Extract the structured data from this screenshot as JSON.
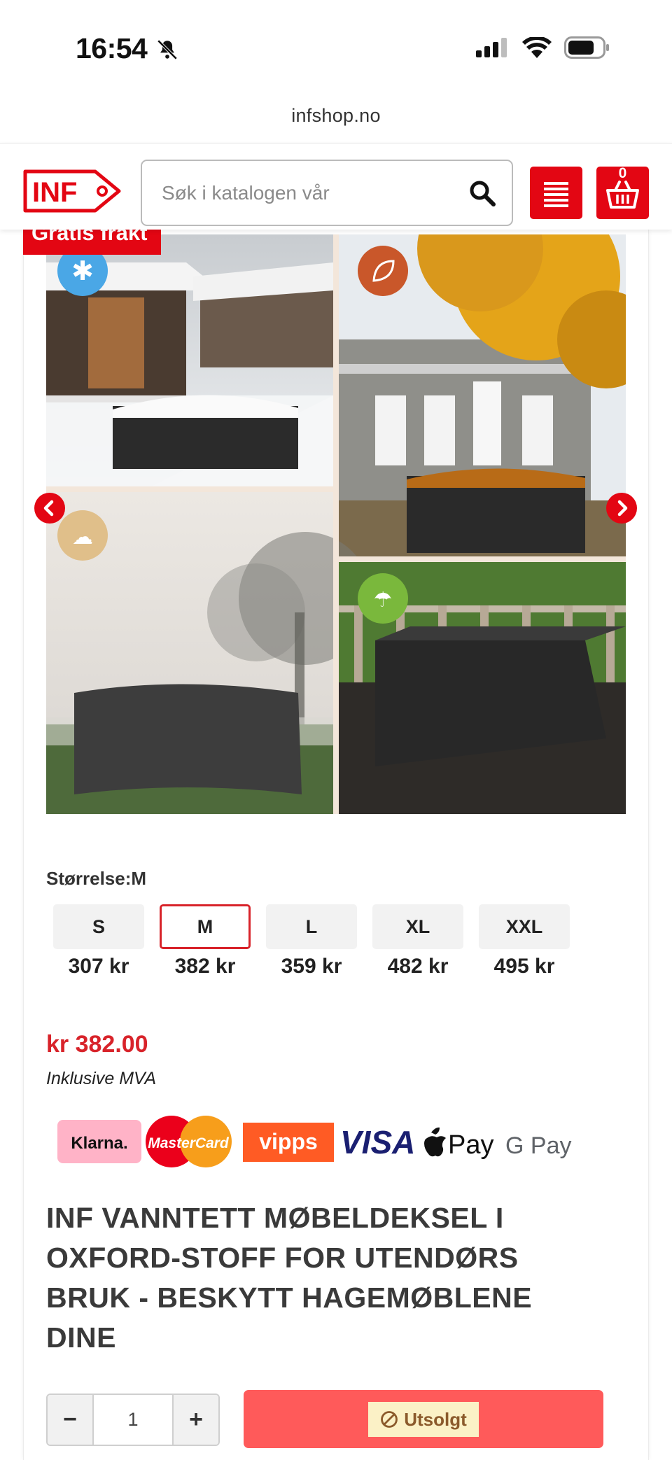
{
  "status_bar": {
    "time": "16:54"
  },
  "browser": {
    "url": "infshop.no"
  },
  "header": {
    "logo_text": "INF",
    "search_placeholder": "Søk i katalogen vår",
    "cart_count": "0"
  },
  "product": {
    "badge": "Gratis frakt",
    "size_label": "Størrelse:M",
    "sizes": [
      {
        "label": "S",
        "price": "307 kr",
        "selected": false
      },
      {
        "label": "M",
        "price": "382 kr",
        "selected": true
      },
      {
        "label": "L",
        "price": "359 kr",
        "selected": false
      },
      {
        "label": "XL",
        "price": "482 kr",
        "selected": false
      },
      {
        "label": "XXL",
        "price": "495 kr",
        "selected": false
      }
    ],
    "price": "kr 382.00",
    "vat_note": "Inklusive MVA",
    "payment_methods": [
      "Klarna.",
      "MasterCard",
      "vipps",
      "VISA",
      "Pay",
      "G Pay"
    ],
    "title": "INF VANNTETT MØBELDEKSEL I OXFORD-STOFF FOR UTENDØRS BRUK - BESKYTT HAGEMØBLENE DINE",
    "quantity": "1",
    "soldout_label": "Utsolgt"
  },
  "colors": {
    "brand_red": "#e30613",
    "price_red": "#d8232a",
    "soldout_bg": "#ff5a5a"
  },
  "icons": [
    "bell-slash-icon",
    "signal-icon",
    "wifi-icon",
    "battery-icon",
    "search-icon",
    "menu-icon",
    "cart-icon",
    "chevron-left-icon",
    "chevron-right-icon",
    "snowflake-icon",
    "leaf-icon",
    "weather-icon",
    "rain-icon",
    "ban-icon"
  ]
}
